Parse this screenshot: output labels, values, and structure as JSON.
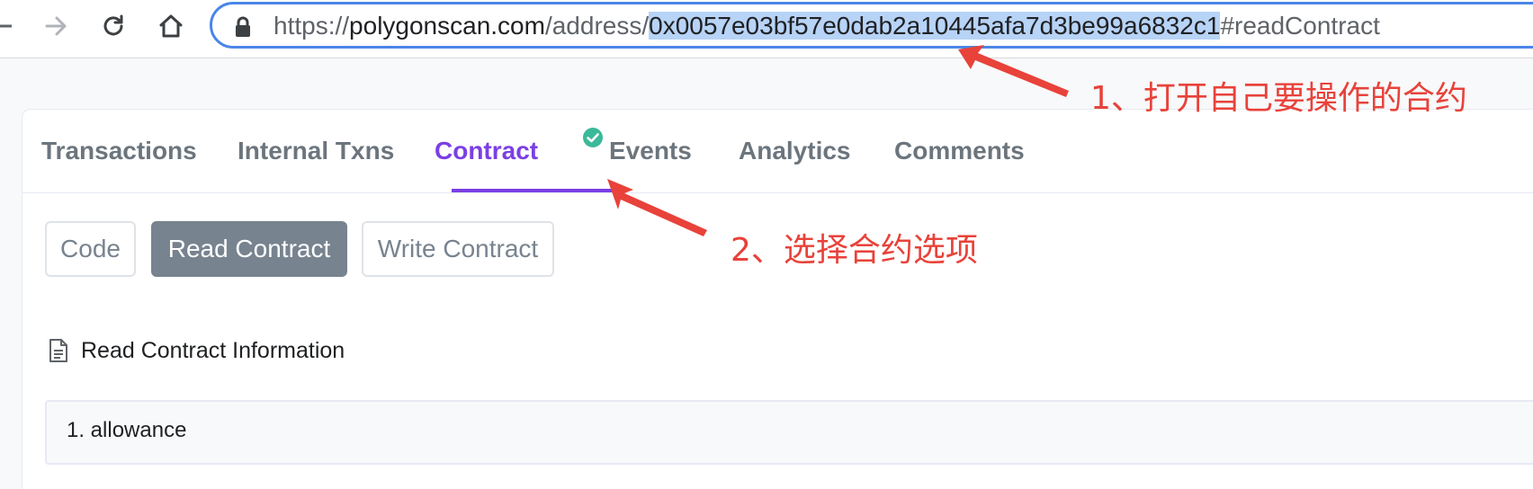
{
  "browser": {
    "url": {
      "scheme": "https://",
      "host": "polygonscan.com",
      "path": "/address/",
      "highlighted": "0x0057e03bf57e0dab2a10445afa7d3be99a6832c1",
      "fragment": "#readContract"
    }
  },
  "tabs": [
    {
      "label": "Transactions"
    },
    {
      "label": "Internal Txns"
    },
    {
      "label": "Contract"
    },
    {
      "label": "Events"
    },
    {
      "label": "Analytics"
    },
    {
      "label": "Comments"
    }
  ],
  "active_tab": "Contract",
  "sub_tabs": [
    {
      "label": "Code"
    },
    {
      "label": "Read Contract"
    },
    {
      "label": "Write Contract"
    }
  ],
  "active_sub_tab": "Read Contract",
  "section_title": "Read Contract Information",
  "functions": [
    {
      "label": "1. allowance"
    }
  ],
  "annotations": [
    {
      "text": "1、打开自己要操作的合约"
    },
    {
      "text": "2、选择合约选项"
    }
  ],
  "colors": {
    "accent": "#7b3fe4",
    "verified": "#3cb99a",
    "annotation": "#e8423a",
    "url_highlight": "#b7d3f6",
    "address_border": "#4a86e8"
  },
  "icons": {
    "back": "back-arrow-icon",
    "forward": "forward-arrow-icon",
    "reload": "reload-icon",
    "home": "home-icon",
    "lock": "lock-icon",
    "verified": "check-circle-icon",
    "document": "document-icon"
  }
}
